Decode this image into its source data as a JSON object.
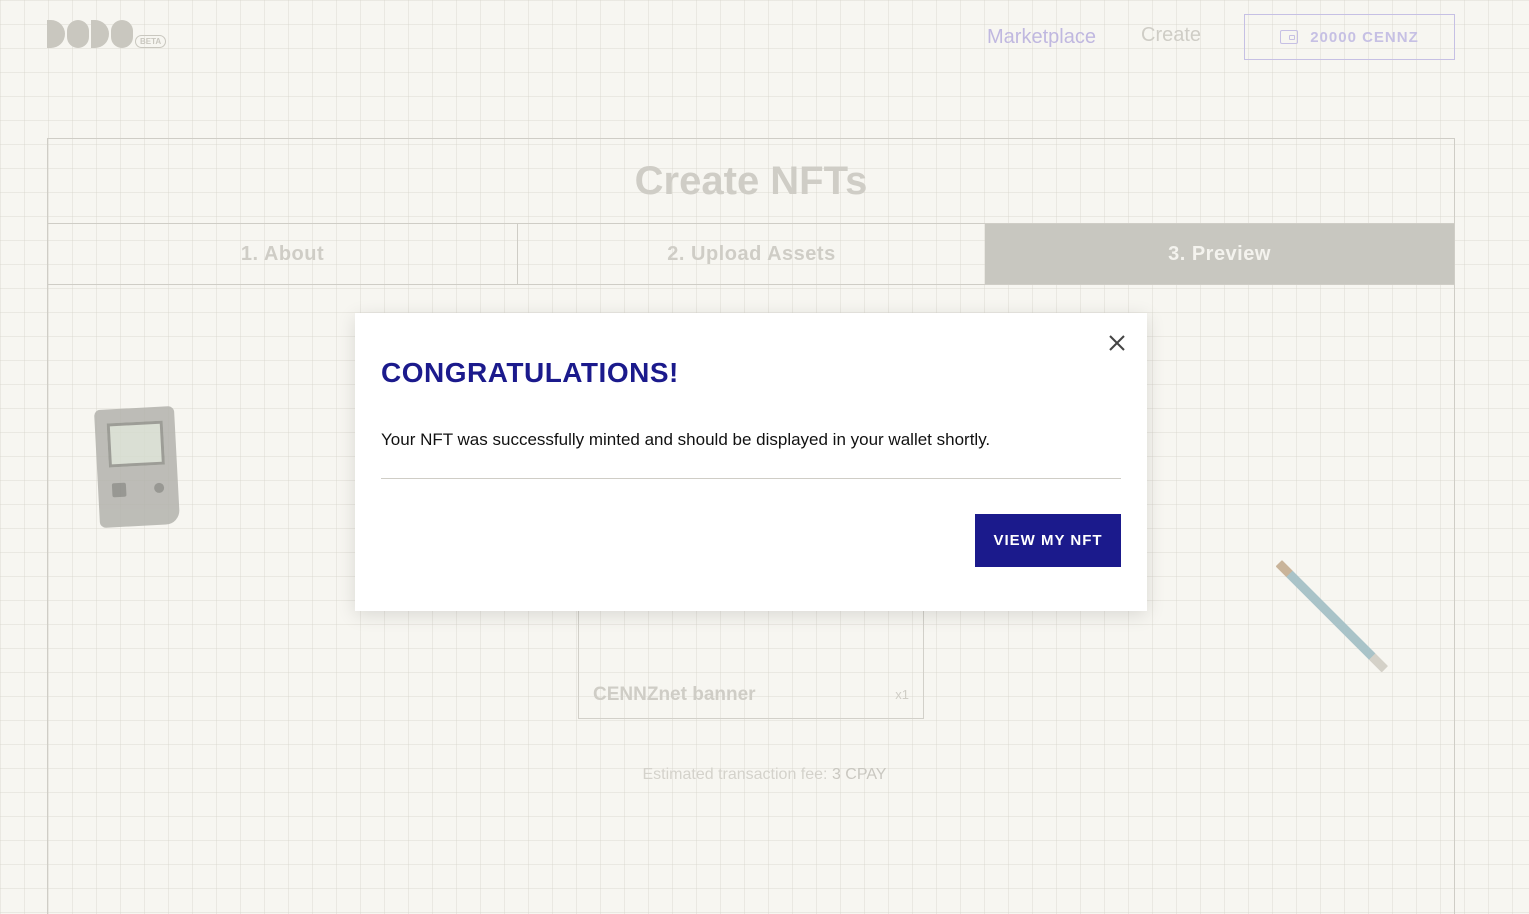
{
  "header": {
    "logo_badge": "BETA",
    "nav": {
      "marketplace": "Marketplace",
      "create": "Create"
    },
    "wallet": {
      "icon": "wallet-icon",
      "balance": "20000 CENNZ"
    }
  },
  "page": {
    "title": "Create NFTs",
    "steps": [
      {
        "label": "1. About",
        "active": false
      },
      {
        "label": "2. Upload Assets",
        "active": false
      },
      {
        "label": "3. Preview",
        "active": true
      }
    ]
  },
  "preview": {
    "nft_name": "CENNZnet banner",
    "quantity": "x1",
    "fee_label": "Estimated transaction fee:",
    "fee_amount": "3 CPAY"
  },
  "modal": {
    "title": "CONGRATULATIONS!",
    "message": "Your NFT was successfully minted and should be displayed in your wallet shortly.",
    "action_label": "VIEW MY NFT",
    "close_icon": "close-icon"
  },
  "colors": {
    "accent": "#1b1a8c",
    "nav_active": "#c0b8e0",
    "background": "#f7f6f1"
  }
}
